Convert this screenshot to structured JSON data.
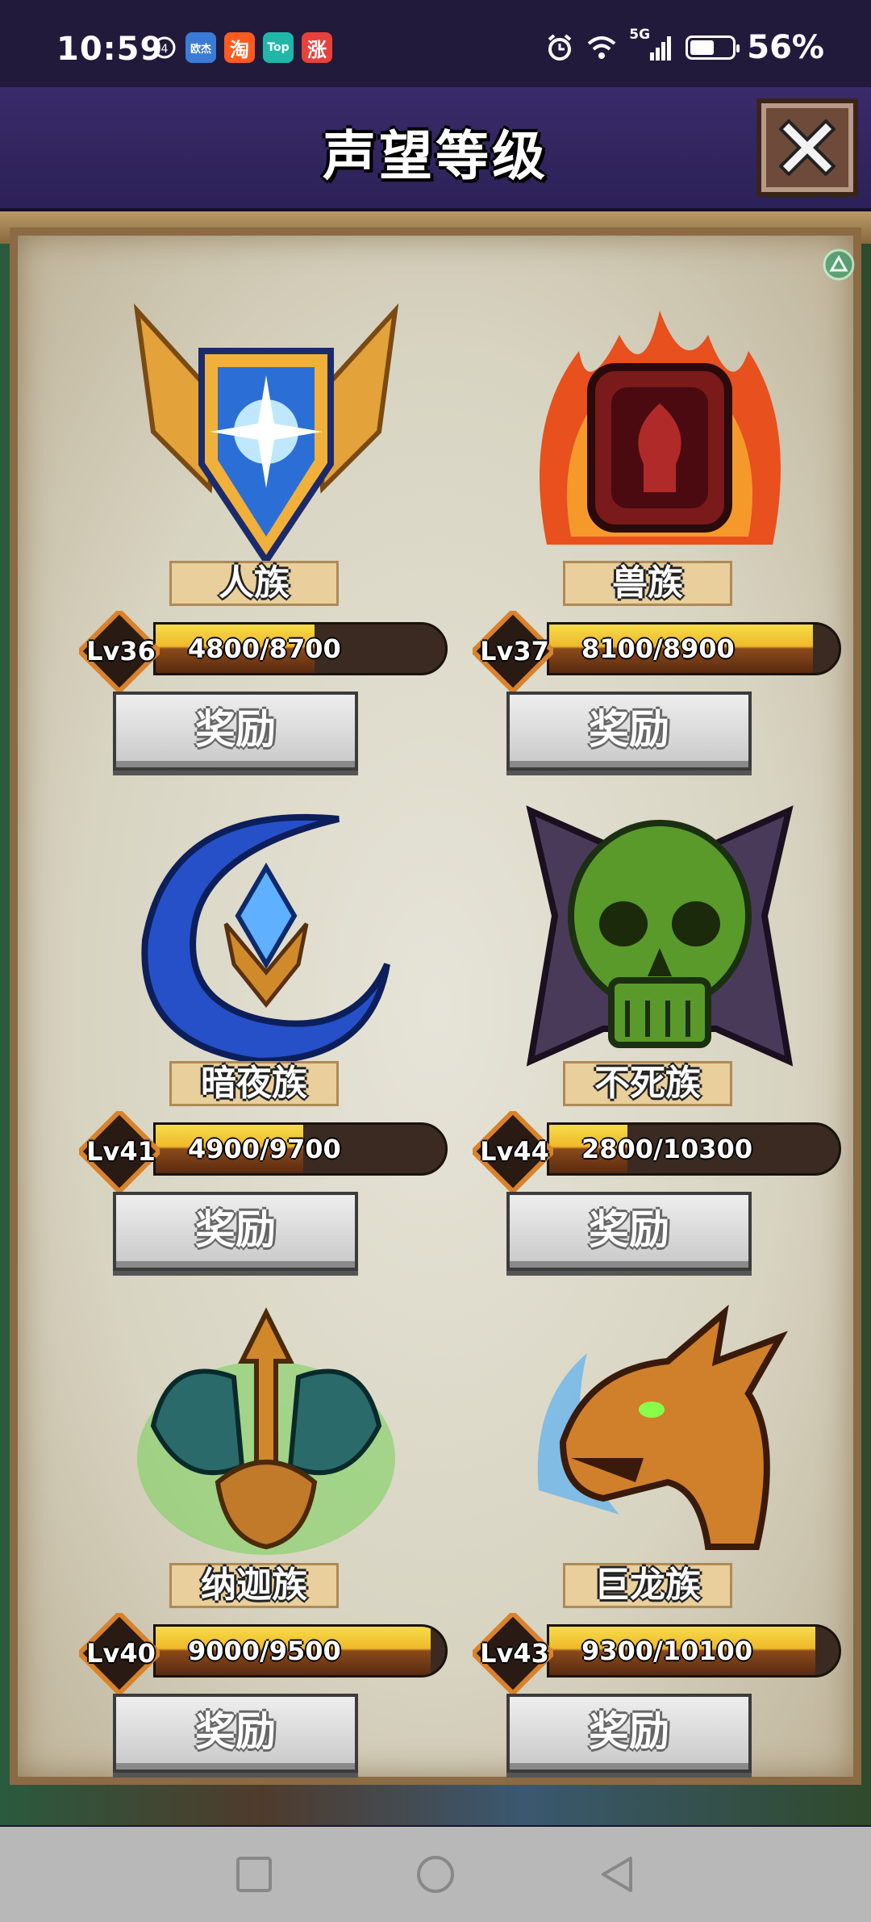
{
  "status_bar": {
    "time": "10:59",
    "apps": [
      {
        "icon": "notification-app-icon",
        "label": "欧杰",
        "color": "#3b7bd8"
      },
      {
        "icon": "taobao-icon",
        "label": "淘",
        "color": "#ff5a1f"
      },
      {
        "icon": "top-app-icon",
        "label": "Top",
        "color": "#1fb8a8"
      },
      {
        "icon": "zhang-app-icon",
        "label": "涨",
        "color": "#e8413b"
      }
    ],
    "network": "5G",
    "battery": "56%"
  },
  "header": {
    "title": "声望等级",
    "close_icon": "close-icon"
  },
  "factions": [
    {
      "name": "人族",
      "level": "Lv36",
      "progress_text": "4800/8700",
      "progress": 0.55,
      "reward_label": "奖励",
      "emblem": "winged-shield-icon"
    },
    {
      "name": "兽族",
      "level": "Lv37",
      "progress_text": "8100/8900",
      "progress": 0.91,
      "reward_label": "奖励",
      "emblem": "flame-horde-icon"
    },
    {
      "name": "暗夜族",
      "level": "Lv41",
      "progress_text": "4900/9700",
      "progress": 0.51,
      "reward_label": "奖励",
      "emblem": "crescent-moon-icon"
    },
    {
      "name": "不死族",
      "level": "Lv44",
      "progress_text": "2800/10300",
      "progress": 0.27,
      "reward_label": "奖励",
      "emblem": "skull-icon"
    },
    {
      "name": "纳迦族",
      "level": "Lv40",
      "progress_text": "9000/9500",
      "progress": 0.95,
      "reward_label": "奖励",
      "emblem": "trident-icon"
    },
    {
      "name": "巨龙族",
      "level": "Lv43",
      "progress_text": "9300/10100",
      "progress": 0.92,
      "reward_label": "奖励",
      "emblem": "dragon-head-icon"
    }
  ],
  "nav": {
    "square": "recent-apps-icon",
    "circle": "home-icon",
    "triangle": "back-icon"
  }
}
